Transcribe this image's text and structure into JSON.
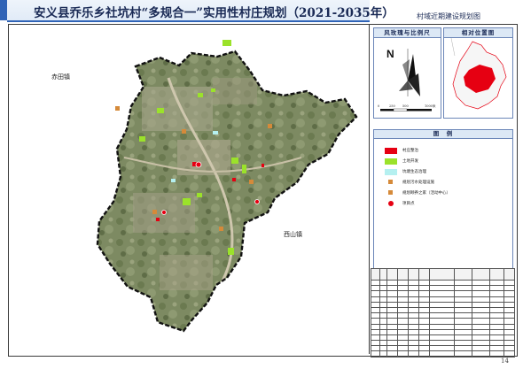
{
  "header": {
    "title": "安义县乔乐乡社坑村“多规合一”实用性村庄规划（2021-2035年）",
    "sheet_name": "村域近期建设规划图"
  },
  "map": {
    "places": {
      "west_town": "赤田镇",
      "east_town": "西山镇"
    },
    "colors": {
      "village_boundary": "#111111",
      "project_red": "#e60012",
      "land_green": "#9be22a",
      "pond_cyan": "#b5f0f0",
      "facility_orange": "#d58a3a"
    }
  },
  "compass": {
    "title": "风玫瑰与比例尺",
    "north": "N",
    "scale_ticks": [
      "0",
      "250",
      "500",
      "1000"
    ],
    "scale_unit": "米"
  },
  "location": {
    "title": "相对位置图"
  },
  "legend": {
    "title": "图　例",
    "items": [
      {
        "label": "村庄整治",
        "color": "#e60012"
      },
      {
        "label": "土地开发",
        "color": "#9be22a"
      },
      {
        "label": "坑塘生态治理",
        "color": "#b5f0f0"
      },
      {
        "label": "规划污水处理设施",
        "color": "#d58a3a"
      },
      {
        "label": "规划颐养之家（活动中心）",
        "color": "#d58a3a"
      },
      {
        "label": "项目点",
        "color": "#e60012"
      }
    ]
  },
  "page_number": "14"
}
